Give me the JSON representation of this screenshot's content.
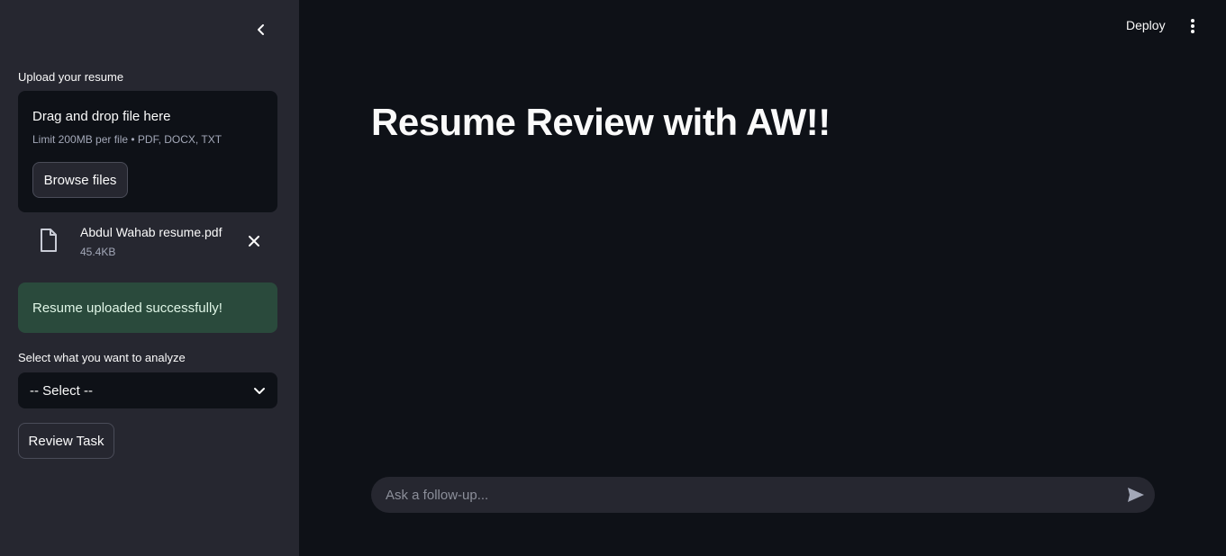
{
  "sidebar": {
    "upload_label": "Upload your resume",
    "uploader": {
      "title": "Drag and drop file here",
      "limit": "Limit 200MB per file • PDF, DOCX, TXT",
      "browse_label": "Browse files"
    },
    "file": {
      "name": "Abdul Wahab resume.pdf",
      "size": "45.4KB"
    },
    "success_message": "Resume uploaded successfully!",
    "select_label": "Select what you want to analyze",
    "select_value": "-- Select --",
    "review_button": "Review Task"
  },
  "header": {
    "deploy_label": "Deploy"
  },
  "main": {
    "title": "Resume Review with AW!!",
    "chat_placeholder": "Ask a follow-up..."
  },
  "colors": {
    "main_bg": "#0e1117",
    "sidebar_bg": "#262730",
    "success_bg": "#2a4a3c"
  },
  "icons": [
    "chevron-left-icon",
    "file-icon",
    "close-icon",
    "chevron-down-icon",
    "kebab-menu-icon",
    "send-icon"
  ]
}
